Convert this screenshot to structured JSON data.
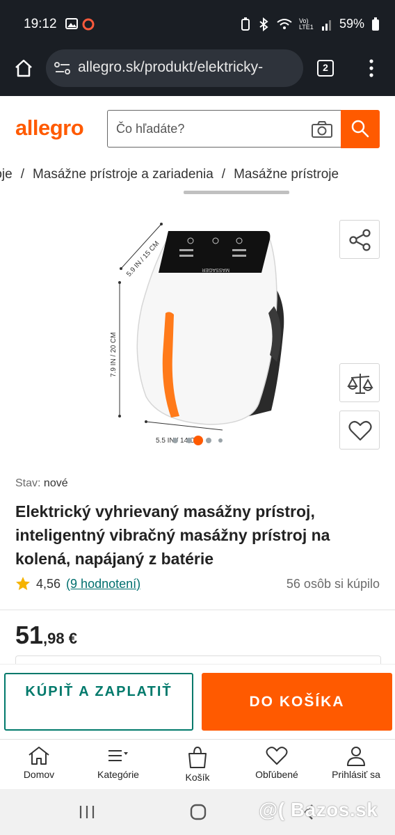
{
  "status_bar": {
    "time": "19:12",
    "network": "Vo) LTE1",
    "battery": "59%"
  },
  "browser": {
    "url": "allegro.sk/produkt/elektricky-",
    "tab_count": "2"
  },
  "header": {
    "logo": "allegro",
    "search_placeholder": "Čo hľadáte?"
  },
  "breadcrumb": [
    "roje",
    "Masážne prístroje a zariadenia",
    "Masážne prístroje"
  ],
  "gallery": {
    "dimension_height": "5.9 IN / 15 CM",
    "dimension_side": "7.9 IN / 20 CM",
    "dimension_width": "5.5 IN / 14 CM",
    "device_label": "MASSAGER",
    "active_index": 3,
    "image_count": 5
  },
  "product": {
    "condition_label": "Stav:",
    "condition_value": "nové",
    "title": "Elektrický vyhrievaný masážny prístroj, inteligentný vibračný masážny prístroj na kolená, napájaný z batérie",
    "rating": "4,56",
    "reviews_link": "(9 hodnotení)",
    "bought": "56 osôb si kúpilo",
    "price_main": "51",
    "price_cents": ",98 €"
  },
  "actions": {
    "buy_now": "KÚPIŤ A ZAPLATIŤ",
    "add_to_cart": "DO KOŠÍKA"
  },
  "bottom_nav": [
    {
      "label": "Domov",
      "icon": "home-icon"
    },
    {
      "label": "Kategórie",
      "icon": "categories-icon"
    },
    {
      "label": "Košík",
      "icon": "cart-icon"
    },
    {
      "label": "Obľúbené",
      "icon": "heart-icon"
    },
    {
      "label": "Prihlásiť sa",
      "icon": "user-icon"
    }
  ],
  "watermark": "@( Bazos.sk",
  "colors": {
    "brand": "#ff5a00",
    "teal": "#00796b",
    "dark_bar": "#1a1e24"
  }
}
